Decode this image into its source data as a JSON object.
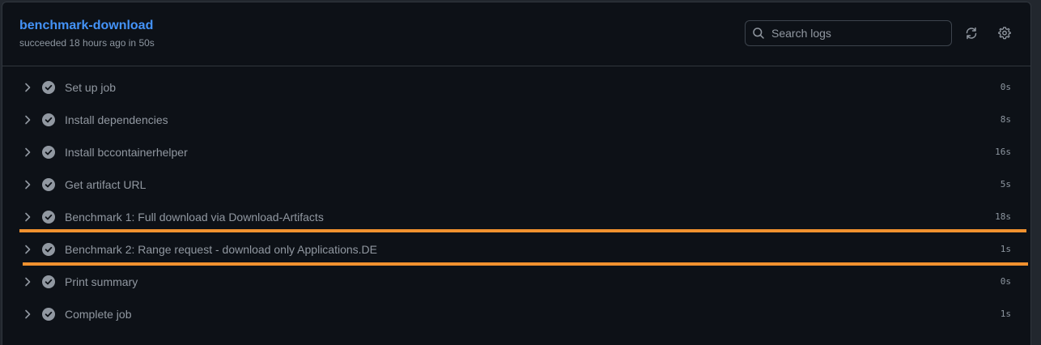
{
  "job": {
    "title": "benchmark-download",
    "status": "succeeded 18 hours ago in 50s"
  },
  "search": {
    "placeholder": "Search logs",
    "icon": "search-icon"
  },
  "toolbar": {
    "refresh_icon": "refresh-icon",
    "settings_icon": "gear-icon"
  },
  "colors": {
    "title": "#4493f8",
    "highlight": "#f0912f",
    "background": "#0d1117"
  },
  "steps": [
    {
      "name": "Set up job",
      "duration": "0s",
      "status": "success"
    },
    {
      "name": "Install dependencies",
      "duration": "8s",
      "status": "success"
    },
    {
      "name": "Install bccontainerhelper",
      "duration": "16s",
      "status": "success"
    },
    {
      "name": "Get artifact URL",
      "duration": "5s",
      "status": "success"
    },
    {
      "name": "Benchmark 1: Full download via Download-Artifacts",
      "duration": "18s",
      "status": "success"
    },
    {
      "name": "Benchmark 2: Range request - download only Applications.DE",
      "duration": "1s",
      "status": "success"
    },
    {
      "name": "Print summary",
      "duration": "0s",
      "status": "success"
    },
    {
      "name": "Complete job",
      "duration": "1s",
      "status": "success"
    }
  ]
}
